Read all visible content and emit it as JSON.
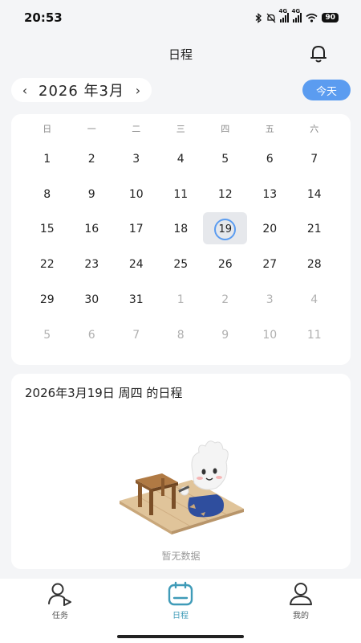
{
  "status_bar": {
    "time": "20:53",
    "signal1_label": "4G",
    "signal2_label": "4G",
    "battery": "90",
    "icons": [
      "bluetooth-icon",
      "mute-bell-icon",
      "signal-icon",
      "signal-icon",
      "wifi-icon",
      "battery-icon"
    ]
  },
  "header": {
    "title": "日程",
    "icon": "bell-icon"
  },
  "month_nav": {
    "prev": "‹",
    "label": "2026 年3月",
    "next": "›"
  },
  "today_button": "今天",
  "calendar": {
    "weekdays": [
      "日",
      "一",
      "二",
      "三",
      "四",
      "五",
      "六"
    ],
    "days": [
      {
        "d": "1",
        "muted": false
      },
      {
        "d": "2",
        "muted": false
      },
      {
        "d": "3",
        "muted": false
      },
      {
        "d": "4",
        "muted": false
      },
      {
        "d": "5",
        "muted": false
      },
      {
        "d": "6",
        "muted": false
      },
      {
        "d": "7",
        "muted": false
      },
      {
        "d": "8",
        "muted": false
      },
      {
        "d": "9",
        "muted": false
      },
      {
        "d": "10",
        "muted": false
      },
      {
        "d": "11",
        "muted": false
      },
      {
        "d": "12",
        "muted": false
      },
      {
        "d": "13",
        "muted": false
      },
      {
        "d": "14",
        "muted": false
      },
      {
        "d": "15",
        "muted": false
      },
      {
        "d": "16",
        "muted": false
      },
      {
        "d": "17",
        "muted": false
      },
      {
        "d": "18",
        "muted": false
      },
      {
        "d": "19",
        "muted": false,
        "selected": true
      },
      {
        "d": "20",
        "muted": false
      },
      {
        "d": "21",
        "muted": false
      },
      {
        "d": "22",
        "muted": false
      },
      {
        "d": "23",
        "muted": false
      },
      {
        "d": "24",
        "muted": false
      },
      {
        "d": "25",
        "muted": false
      },
      {
        "d": "26",
        "muted": false
      },
      {
        "d": "27",
        "muted": false
      },
      {
        "d": "28",
        "muted": false
      },
      {
        "d": "29",
        "muted": false
      },
      {
        "d": "30",
        "muted": false
      },
      {
        "d": "31",
        "muted": false
      },
      {
        "d": "1",
        "muted": true
      },
      {
        "d": "2",
        "muted": true
      },
      {
        "d": "3",
        "muted": true
      },
      {
        "d": "4",
        "muted": true
      },
      {
        "d": "5",
        "muted": true
      },
      {
        "d": "6",
        "muted": true
      },
      {
        "d": "7",
        "muted": true
      },
      {
        "d": "8",
        "muted": true
      },
      {
        "d": "9",
        "muted": true
      },
      {
        "d": "10",
        "muted": true
      },
      {
        "d": "11",
        "muted": true
      }
    ]
  },
  "schedule": {
    "title": "2026年3月19日 周四 的日程",
    "empty_text": "暂无数据"
  },
  "tabs": [
    {
      "label": "任务",
      "icon": "user-flag-icon",
      "active": false
    },
    {
      "label": "日程",
      "icon": "calendar-icon",
      "active": true
    },
    {
      "label": "我的",
      "icon": "profile-icon",
      "active": false
    }
  ],
  "colors": {
    "accent": "#5b9cf0",
    "tab_active": "#3f9bb8",
    "background": "#f4f5f7"
  }
}
